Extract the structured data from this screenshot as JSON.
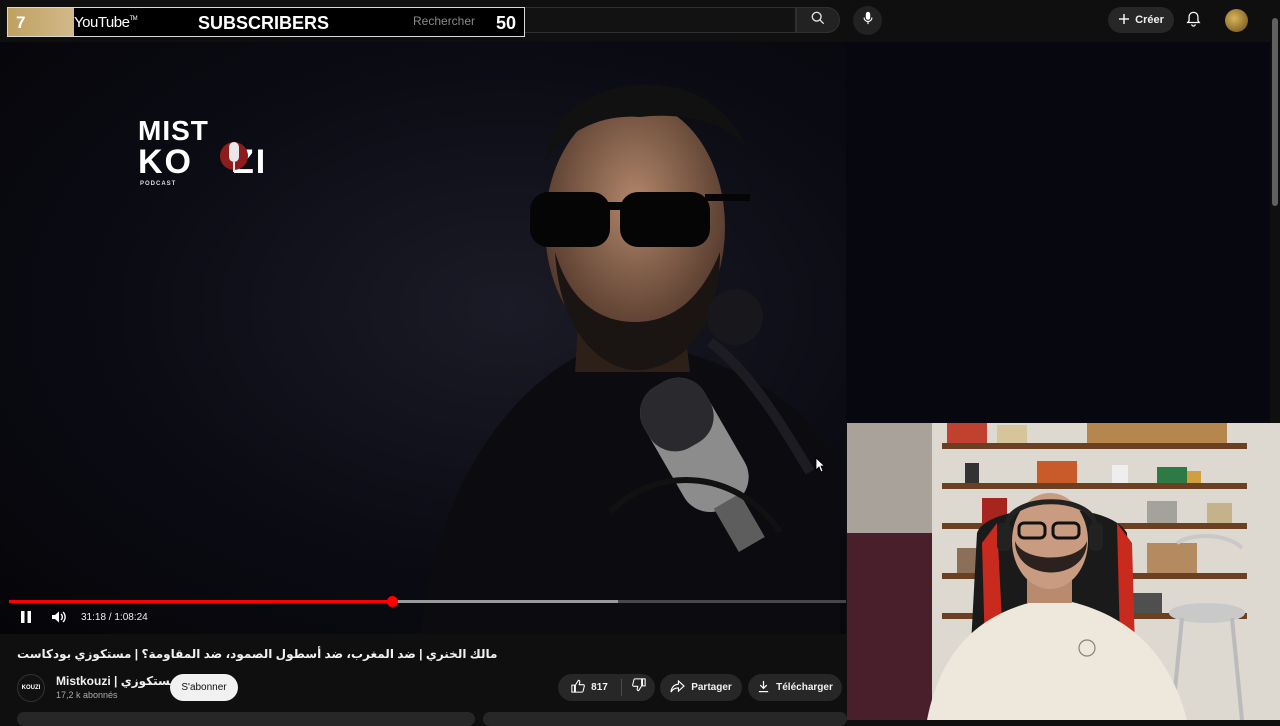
{
  "header": {
    "search_placeholder": "Rechercher",
    "create_label": "Créer"
  },
  "subscriber_widget": {
    "rank": "7",
    "brand": "YouTube",
    "brand_mark": "TM",
    "label": "SUBSCRIBERS",
    "search_text": "Rechercher",
    "count": "50"
  },
  "video": {
    "logo_line1": "MIST",
    "logo_line2a": "KO",
    "logo_line2b": "ZI",
    "logo_tag": "PODCAST",
    "current_time": "31:18",
    "duration": "1:08:24",
    "time_text": "31:18 / 1:08:24",
    "progress_fraction": 0.458,
    "buffer_fraction": 0.728
  },
  "details": {
    "title": "مالك الخنري | ضد المغرب، ضد أسطول الصمود، ضد المقاومة؟ | مستكوزي بودكاست",
    "channel_avatar_text": "KOUZI",
    "channel_name": "Mistkouzi | مستكوزي",
    "channel_subs": "17,2 k abonnés",
    "subscribe_label": "S'abonner",
    "likes": "817",
    "share_label": "Partager",
    "download_label": "Télécharger"
  },
  "colors": {
    "accent": "#ff0000",
    "background": "#0f0f0f",
    "chip": "#272727"
  },
  "icons": [
    "search-icon",
    "mic-icon",
    "plus-icon",
    "bell-icon",
    "pause-icon",
    "volume-icon",
    "thumbs-up-icon",
    "thumbs-down-icon",
    "share-icon",
    "download-icon",
    "cursor-icon"
  ]
}
